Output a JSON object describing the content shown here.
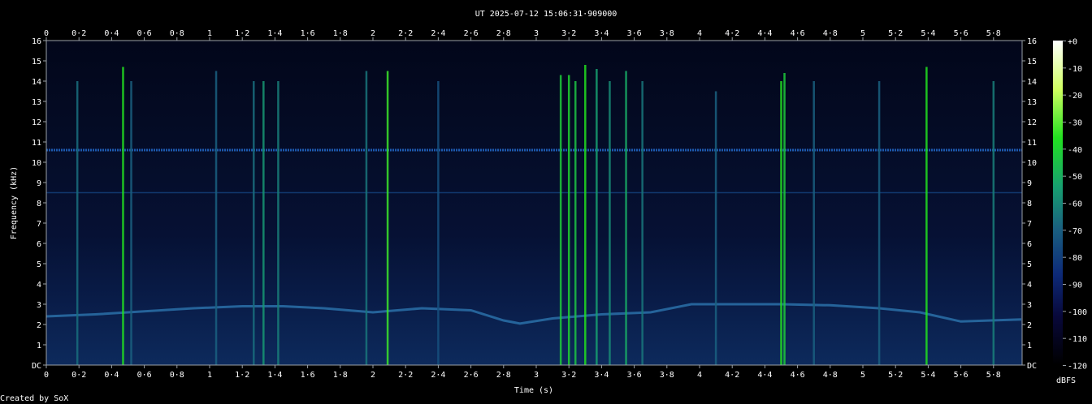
{
  "chart_data": {
    "type": "heatmap",
    "title": "UT 2025-07-12 15:06:31·909000",
    "xlabel": "Time (s)",
    "ylabel": "Frequency (kHz)",
    "credit": "Created by SoX",
    "xlim": [
      0,
      5.97
    ],
    "ylim": [
      0,
      16
    ],
    "x_ticks": [
      "0",
      "0·2",
      "0·4",
      "0·6",
      "0·8",
      "1",
      "1·2",
      "1·4",
      "1·6",
      "1·8",
      "2",
      "2·2",
      "2·4",
      "2·6",
      "2·8",
      "3",
      "3·2",
      "3·4",
      "3·6",
      "3·8",
      "4",
      "4·2",
      "4·4",
      "4·6",
      "4·8",
      "5",
      "5·2",
      "5·4",
      "5·6",
      "5·8"
    ],
    "y_ticks": [
      "DC",
      "1",
      "2",
      "3",
      "4",
      "5",
      "6",
      "7",
      "8",
      "9",
      "10",
      "11",
      "12",
      "13",
      "14",
      "15",
      "16"
    ],
    "colorbar": {
      "label": "dBFS",
      "ticks": [
        "+0",
        "-10",
        "-20",
        "-30",
        "-40",
        "-50",
        "-60",
        "-70",
        "-80",
        "-90",
        "-100",
        "-110",
        "-120"
      ],
      "range": [
        -120,
        0
      ]
    },
    "tones_khz": [
      10.6,
      8.5
    ],
    "fundamental_contour": {
      "time_s": [
        0,
        0.3,
        0.6,
        0.9,
        1.2,
        1.45,
        1.7,
        2.0,
        2.3,
        2.6,
        2.8,
        2.9,
        3.1,
        3.4,
        3.7,
        3.95,
        4.2,
        4.5,
        4.8,
        5.1,
        5.35,
        5.6,
        5.97
      ],
      "freq_khz": [
        2.4,
        2.5,
        2.65,
        2.8,
        2.9,
        2.9,
        2.8,
        2.6,
        2.8,
        2.7,
        2.2,
        2.05,
        2.3,
        2.5,
        2.6,
        3.0,
        3.0,
        3.0,
        2.95,
        2.8,
        2.6,
        2.15,
        2.25
      ]
    },
    "transients": {
      "time_s": [
        0.19,
        0.47,
        0.52,
        1.04,
        1.27,
        1.33,
        1.42,
        1.96,
        2.09,
        2.4,
        3.15,
        3.2,
        3.24,
        3.3,
        3.37,
        3.45,
        3.55,
        3.65,
        4.1,
        4.5,
        4.52,
        4.7,
        5.1,
        5.39,
        5.8
      ],
      "top_khz": [
        14,
        14.7,
        14,
        14.5,
        14,
        14,
        14,
        14.5,
        14.5,
        14,
        14.3,
        14.3,
        14,
        14.8,
        14.6,
        14,
        14.5,
        14,
        13.5,
        14,
        14.4,
        14,
        14,
        14.7,
        14
      ],
      "peak_dbfs": [
        -82,
        -55,
        -85,
        -85,
        -82,
        -72,
        -78,
        -80,
        -52,
        -88,
        -60,
        -58,
        -62,
        -55,
        -70,
        -75,
        -68,
        -80,
        -85,
        -55,
        -60,
        -85,
        -85,
        -55,
        -78
      ]
    }
  }
}
